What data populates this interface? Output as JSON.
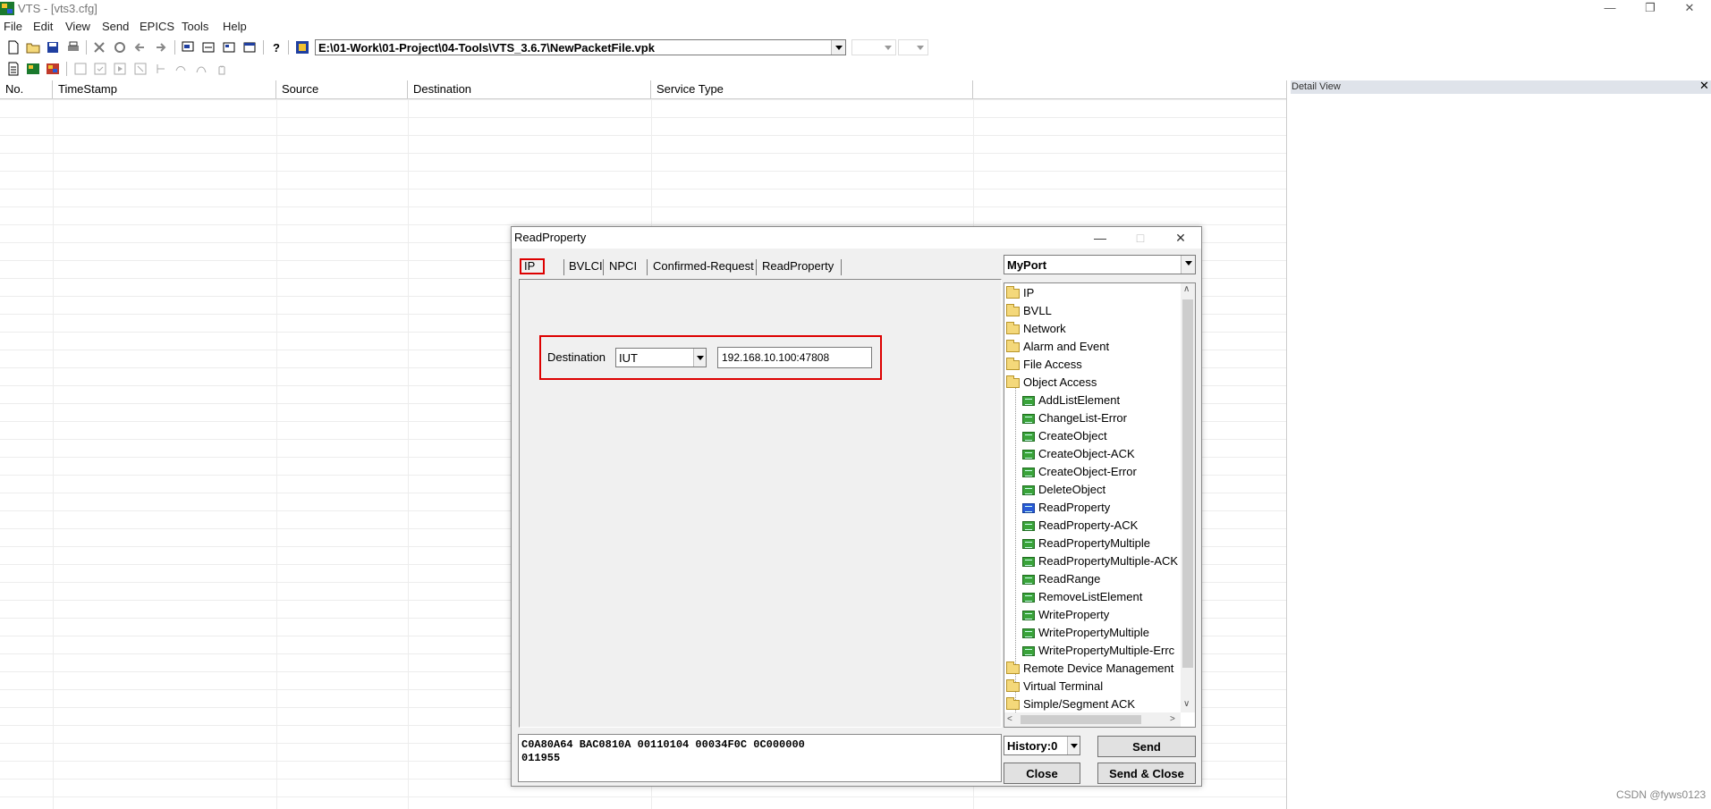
{
  "window": {
    "title": "VTS - [vts3.cfg]"
  },
  "menu": [
    "File",
    "Edit",
    "View",
    "Send",
    "EPICS",
    "Tools",
    "Help"
  ],
  "toolbar": {
    "path": "E:\\01-Work\\01-Project\\04-Tools\\VTS_3.6.7\\NewPacketFile.vpk"
  },
  "packet_list": {
    "columns": [
      "No.",
      "TimeStamp",
      "Source",
      "Destination",
      "Service Type"
    ]
  },
  "detail_view": {
    "title": "Detail View"
  },
  "dialog": {
    "title": "ReadProperty",
    "tabs": [
      "IP",
      "BVLCI",
      "NPCI",
      "Confirmed-Request",
      "ReadProperty"
    ],
    "destination": {
      "label": "Destination",
      "selected": "IUT",
      "address": "192.168.10.100:47808"
    },
    "hex": [
      "C0A80A64 BAC0810A 00110104 00034F0C 0C000000",
      "011955"
    ],
    "port": "MyPort",
    "tree": [
      {
        "label": "IP",
        "type": "folder",
        "level": 0
      },
      {
        "label": "BVLL",
        "type": "folder",
        "level": 0
      },
      {
        "label": "Network",
        "type": "folder",
        "level": 0
      },
      {
        "label": "Alarm and Event",
        "type": "folder",
        "level": 0
      },
      {
        "label": "File Access",
        "type": "folder",
        "level": 0
      },
      {
        "label": "Object Access",
        "type": "folder",
        "level": 0
      },
      {
        "label": "AddListElement",
        "type": "service",
        "level": 1
      },
      {
        "label": "ChangeList-Error",
        "type": "service",
        "level": 1
      },
      {
        "label": "CreateObject",
        "type": "service",
        "level": 1
      },
      {
        "label": "CreateObject-ACK",
        "type": "service",
        "level": 1
      },
      {
        "label": "CreateObject-Error",
        "type": "service",
        "level": 1
      },
      {
        "label": "DeleteObject",
        "type": "service",
        "level": 1
      },
      {
        "label": "ReadProperty",
        "type": "service",
        "level": 1,
        "selected": true
      },
      {
        "label": "ReadProperty-ACK",
        "type": "service",
        "level": 1
      },
      {
        "label": "ReadPropertyMultiple",
        "type": "service",
        "level": 1
      },
      {
        "label": "ReadPropertyMultiple-ACK",
        "type": "service",
        "level": 1
      },
      {
        "label": "ReadRange",
        "type": "service",
        "level": 1
      },
      {
        "label": "RemoveListElement",
        "type": "service",
        "level": 1
      },
      {
        "label": "WriteProperty",
        "type": "service",
        "level": 1
      },
      {
        "label": "WritePropertyMultiple",
        "type": "service",
        "level": 1
      },
      {
        "label": "WritePropertyMultiple-Errc",
        "type": "service",
        "level": 1
      },
      {
        "label": "Remote Device Management",
        "type": "folder",
        "level": 0
      },
      {
        "label": "Virtual Terminal",
        "type": "folder",
        "level": 0
      },
      {
        "label": "Simple/Segment ACK",
        "type": "folder",
        "level": 0
      }
    ],
    "history": "History:0",
    "buttons": {
      "send": "Send",
      "close": "Close",
      "send_close": "Send & Close"
    }
  },
  "watermark": "CSDN @fyws0123"
}
